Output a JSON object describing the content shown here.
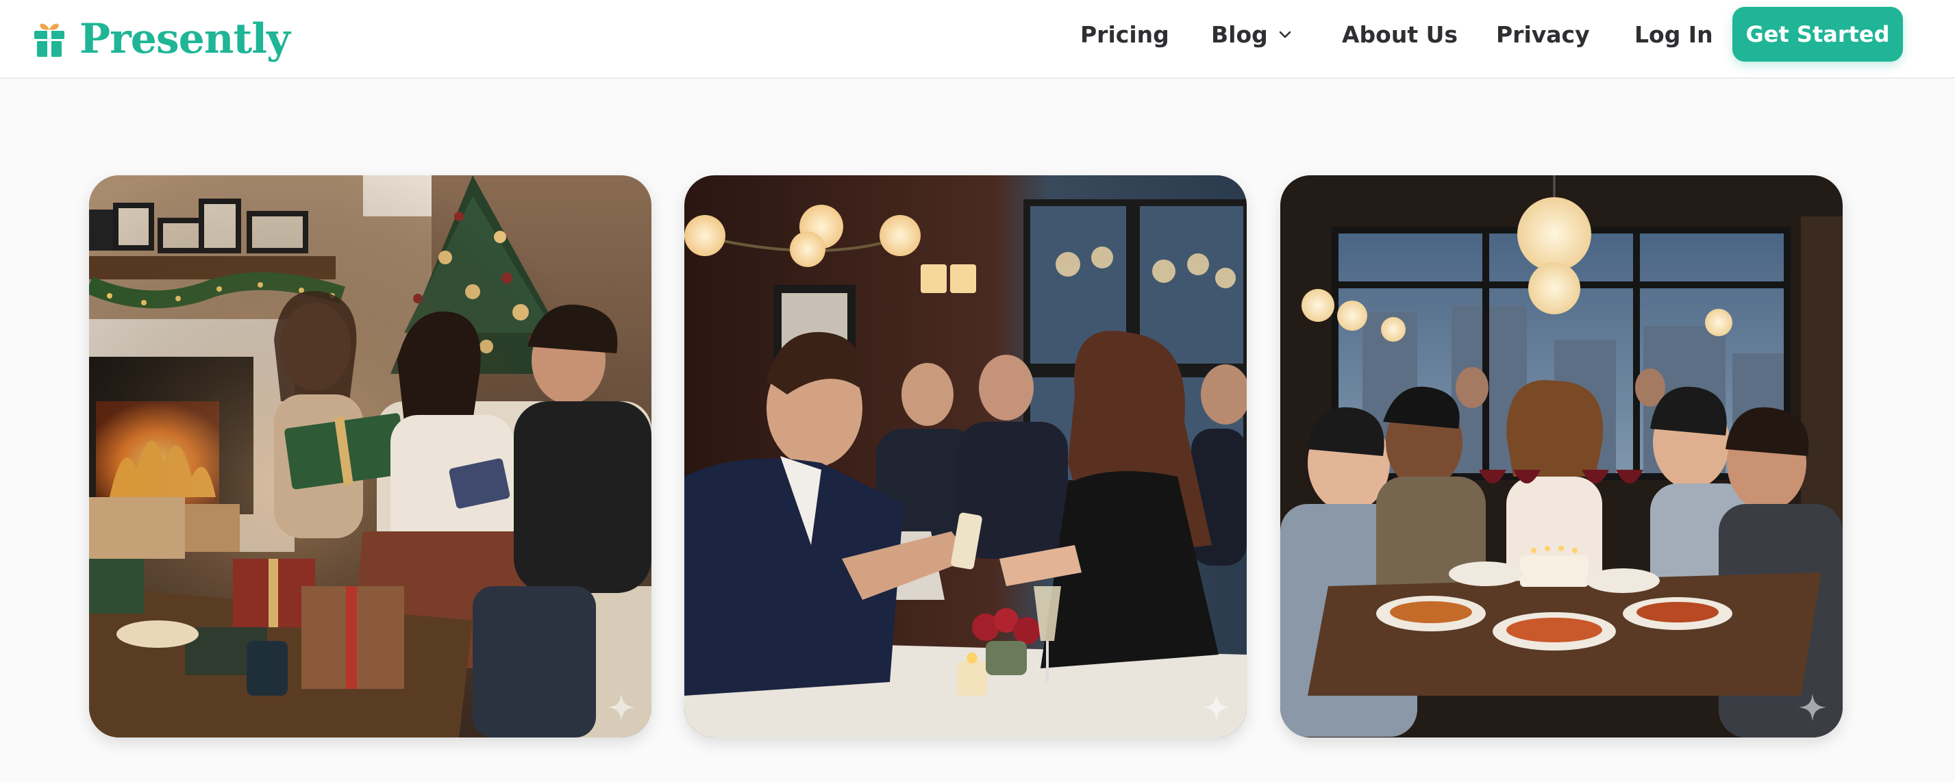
{
  "brand": {
    "name": "Presently",
    "color": "#1fb596"
  },
  "nav": {
    "pricing": "Pricing",
    "blog": "Blog",
    "about": "About Us",
    "privacy": "Privacy",
    "login": "Log In",
    "cta": "Get Started"
  },
  "icons": {
    "logo": "gift-icon",
    "blog_dropdown": "chevron-down-icon",
    "card_badge": "sparkle-icon"
  },
  "gallery": [
    {
      "scene": "holiday gift exchange by the fireplace"
    },
    {
      "scene": "couple exchanging a gift at a dinner table"
    },
    {
      "scene": "friends toasting at a birthday dinner"
    }
  ]
}
